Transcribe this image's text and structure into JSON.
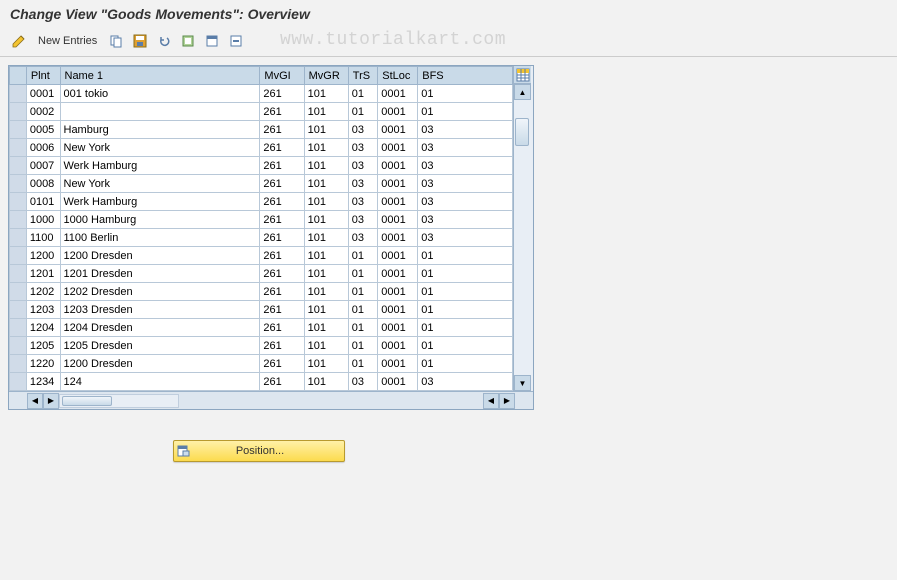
{
  "title": "Change View \"Goods Movements\": Overview",
  "toolbar": {
    "new_entries": "New Entries"
  },
  "watermark": "www.tutorialkart.com",
  "columns": {
    "plnt": "Plnt",
    "name1": "Name 1",
    "mvgi": "MvGI",
    "mvgr": "MvGR",
    "trs": "TrS",
    "stloc": "StLoc",
    "bfs": "BFS"
  },
  "rows": [
    {
      "plnt": "0001",
      "name": "001 tokio",
      "mvgi": "261",
      "mvgr": "101",
      "trs": "01",
      "stloc": "0001",
      "bfs": "01"
    },
    {
      "plnt": "0002",
      "name": "",
      "mvgi": "261",
      "mvgr": "101",
      "trs": "01",
      "stloc": "0001",
      "bfs": "01"
    },
    {
      "plnt": "0005",
      "name": "Hamburg",
      "mvgi": "261",
      "mvgr": "101",
      "trs": "03",
      "stloc": "0001",
      "bfs": "03"
    },
    {
      "plnt": "0006",
      "name": "New York",
      "mvgi": "261",
      "mvgr": "101",
      "trs": "03",
      "stloc": "0001",
      "bfs": "03"
    },
    {
      "plnt": "0007",
      "name": "Werk Hamburg",
      "mvgi": "261",
      "mvgr": "101",
      "trs": "03",
      "stloc": "0001",
      "bfs": "03"
    },
    {
      "plnt": "0008",
      "name": "New York",
      "mvgi": "261",
      "mvgr": "101",
      "trs": "03",
      "stloc": "0001",
      "bfs": "03"
    },
    {
      "plnt": "0101",
      "name": "Werk Hamburg",
      "mvgi": "261",
      "mvgr": "101",
      "trs": "03",
      "stloc": "0001",
      "bfs": "03"
    },
    {
      "plnt": "1000",
      "name": "1000 Hamburg",
      "mvgi": "261",
      "mvgr": "101",
      "trs": "03",
      "stloc": "0001",
      "bfs": "03"
    },
    {
      "plnt": "1100",
      "name": "1100 Berlin",
      "mvgi": "261",
      "mvgr": "101",
      "trs": "03",
      "stloc": "0001",
      "bfs": "03"
    },
    {
      "plnt": "1200",
      "name": "1200 Dresden",
      "mvgi": "261",
      "mvgr": "101",
      "trs": "01",
      "stloc": "0001",
      "bfs": "01"
    },
    {
      "plnt": "1201",
      "name": "1201 Dresden",
      "mvgi": "261",
      "mvgr": "101",
      "trs": "01",
      "stloc": "0001",
      "bfs": "01"
    },
    {
      "plnt": "1202",
      "name": "1202 Dresden",
      "mvgi": "261",
      "mvgr": "101",
      "trs": "01",
      "stloc": "0001",
      "bfs": "01"
    },
    {
      "plnt": "1203",
      "name": "1203 Dresden",
      "mvgi": "261",
      "mvgr": "101",
      "trs": "01",
      "stloc": "0001",
      "bfs": "01"
    },
    {
      "plnt": "1204",
      "name": "1204 Dresden",
      "mvgi": "261",
      "mvgr": "101",
      "trs": "01",
      "stloc": "0001",
      "bfs": "01"
    },
    {
      "plnt": "1205",
      "name": "1205 Dresden",
      "mvgi": "261",
      "mvgr": "101",
      "trs": "01",
      "stloc": "0001",
      "bfs": "01"
    },
    {
      "plnt": "1220",
      "name": "1200 Dresden",
      "mvgi": "261",
      "mvgr": "101",
      "trs": "01",
      "stloc": "0001",
      "bfs": "01"
    },
    {
      "plnt": "1234",
      "name": "124",
      "mvgi": "261",
      "mvgr": "101",
      "trs": "03",
      "stloc": "0001",
      "bfs": "03"
    }
  ],
  "position_button": "Position..."
}
